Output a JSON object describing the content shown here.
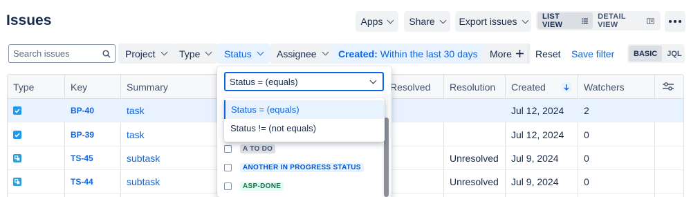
{
  "page": {
    "title": "Issues"
  },
  "top_actions": {
    "apps": "Apps",
    "share": "Share",
    "export": "Export issues",
    "list_view": "LIST VIEW",
    "detail_view": "DETAIL VIEW"
  },
  "filters": {
    "search_placeholder": "Search issues",
    "project": "Project",
    "type": "Type",
    "status": "Status",
    "assignee": "Assignee",
    "created_label": "Created:",
    "created_value": "Within the last 30 days",
    "more": "More",
    "reset": "Reset",
    "save_filter": "Save filter",
    "basic": "BASIC",
    "jql": "JQL"
  },
  "table": {
    "columns": [
      "Type",
      "Key",
      "Summary",
      "Resolved",
      "Resolution",
      "Created",
      "Watchers"
    ],
    "rows": [
      {
        "type": "task",
        "key": "BP-40",
        "summary": "task",
        "resolution": "",
        "created": "Jul 12, 2024",
        "watchers": "2"
      },
      {
        "type": "task",
        "key": "BP-39",
        "summary": "task",
        "resolution": "",
        "created": "Jul 12, 2024",
        "watchers": "0"
      },
      {
        "type": "subtask",
        "key": "TS-45",
        "summary": "subtask",
        "resolution": "Unresolved",
        "created": "Jul 9, 2024",
        "watchers": "0"
      },
      {
        "type": "subtask",
        "key": "TS-44",
        "summary": "subtask",
        "resolution": "Unresolved",
        "created": "Jul 9, 2024",
        "watchers": "0"
      }
    ]
  },
  "status_dropdown": {
    "operator_selected": "Status = (equals)",
    "operator_options": [
      "Status = (equals)",
      "Status != (not equals)"
    ],
    "statuses": [
      "A TO DO",
      "ANOTHER IN PROGRESS STATUS",
      "ASP-DONE"
    ]
  },
  "colors": {
    "accent": "#0C66E4",
    "selected_bg": "#E9F2FF",
    "neutral_btn": "#F1F2F4"
  }
}
